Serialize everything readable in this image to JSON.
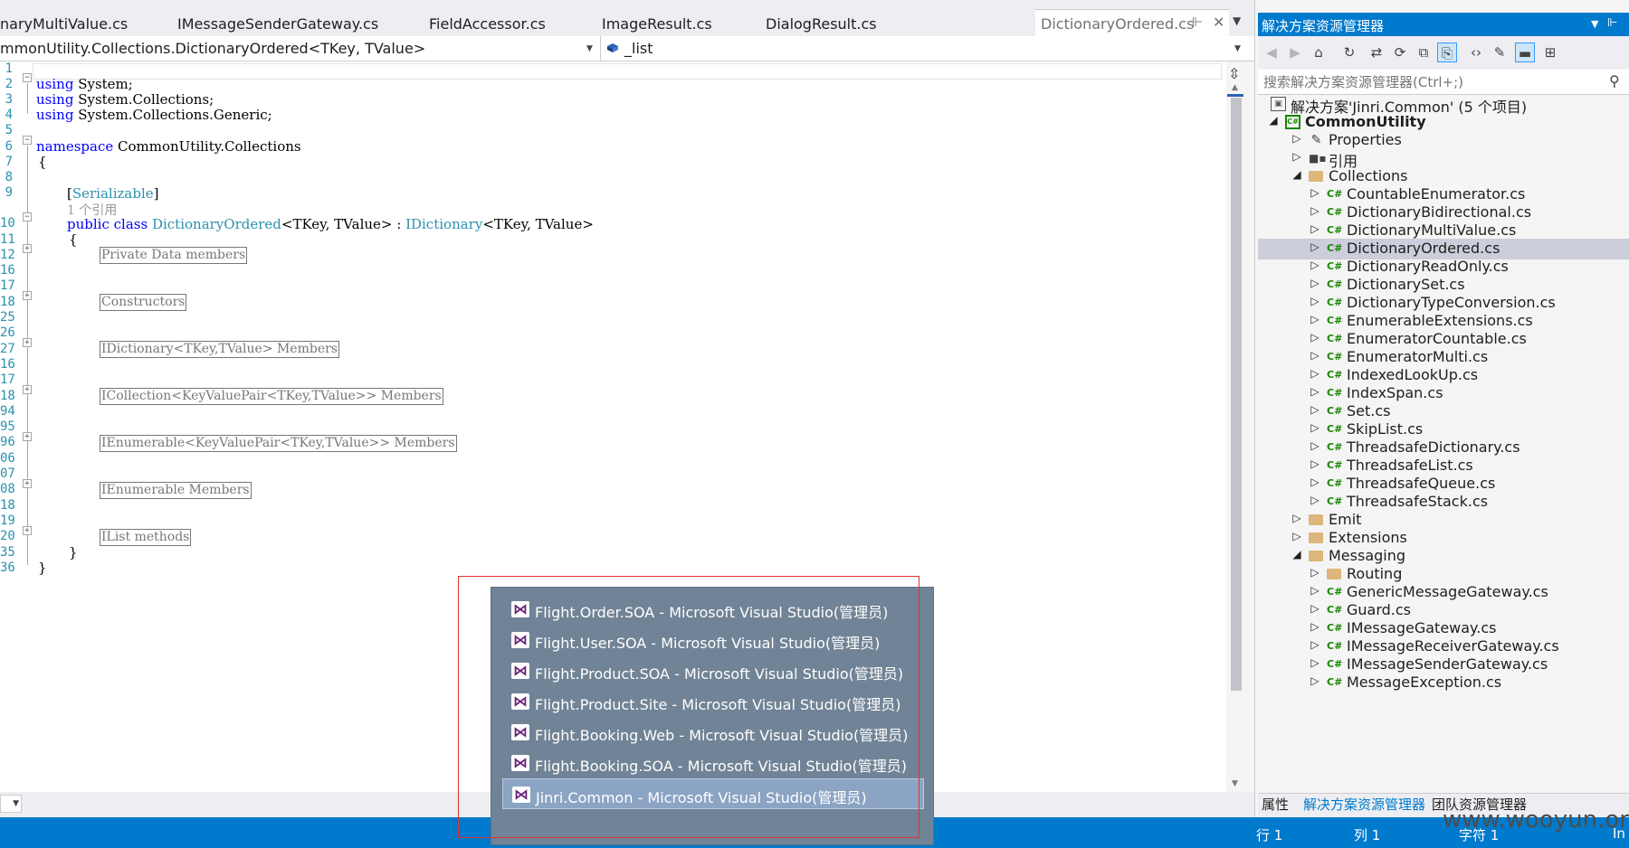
{
  "editor_tabs": [
    "naryMultiValue.cs",
    "IMessageSenderGateway.cs",
    "FieldAccessor.cs",
    "ImageResult.cs",
    "DialogResult.cs"
  ],
  "active_tab": {
    "label": "DictionaryOrdered.cs",
    "pin": "⊩",
    "close": "✕"
  },
  "tab_menu_icon": "chevron-down-icon",
  "nav": {
    "type_scope": "mmonUtility.Collections.DictionaryOrdered<TKey, TValue>",
    "member": "_list",
    "member_icon": "field-icon"
  },
  "line_numbers": [
    "1",
    "2",
    "3",
    "4",
    "5",
    "6",
    "7",
    "8",
    "9",
    "10",
    "11",
    "12",
    "16",
    "17",
    "18",
    "25",
    "26",
    "27",
    "16",
    "17",
    "18",
    "94",
    "95",
    "96",
    "06",
    "07",
    "08",
    "18",
    "19",
    "20",
    "35",
    "36"
  ],
  "code": {
    "using1_kw": "using",
    "using1": " System;",
    "using2_kw": "using",
    "using2": " System.Collections;",
    "using3_kw": "using",
    "using3": " System.Collections.Generic;",
    "ns_kw": "namespace",
    "ns": " CommonUtility.Collections",
    "brace_open": "{",
    "attr_open": "[",
    "attr": "Serializable",
    "attr_close": "]",
    "refs": "1 个引用",
    "class_kw": "public class",
    "class_name": "DictionaryOrdered",
    "class_generic": "<TKey, TValue> : ",
    "iface": "IDictionary",
    "iface_generic": "<TKey, TValue>",
    "class_brace_open": "{",
    "class_brace_close": "}",
    "ns_brace_close": "}",
    "regions": [
      "Private Data members",
      "Constructors",
      "IDictionary<TKey,TValue> Members",
      "ICollection<KeyValuePair<TKey,TValue>> Members",
      "IEnumerable<KeyValuePair<TKey,TValue>> Members",
      "IEnumerable Members",
      "IList methods"
    ]
  },
  "solution_explorer": {
    "title": "解决方案资源管理器",
    "search_placeholder": "搜索解决方案资源管理器(Ctrl+;)",
    "toolbar_icons": [
      "back-icon",
      "forward-icon",
      "home-icon",
      "sync-icon",
      "refresh-icon",
      "collapse-icon",
      "show-all-icon",
      "properties-icon",
      "code-icon",
      "wrench-icon",
      "pin-icon",
      "class-diagram-icon"
    ],
    "tree": [
      {
        "label": "解决方案'Jinri.Common' (5 个项目)",
        "kind": "solution",
        "level": 0,
        "exp": ""
      },
      {
        "label": "CommonUtility",
        "kind": "project",
        "level": 0,
        "exp": "open",
        "bold": true
      },
      {
        "label": "Properties",
        "kind": "wrench",
        "level": 1,
        "exp": "closed"
      },
      {
        "label": "引用",
        "kind": "refs",
        "level": 1,
        "exp": "closed"
      },
      {
        "label": "Collections",
        "kind": "folder",
        "level": 1,
        "exp": "open"
      },
      {
        "label": "CountableEnumerator.cs",
        "kind": "cs",
        "level": 2,
        "exp": "closed"
      },
      {
        "label": "DictionaryBidirectional.cs",
        "kind": "cs",
        "level": 2,
        "exp": "closed"
      },
      {
        "label": "DictionaryMultiValue.cs",
        "kind": "cs",
        "level": 2,
        "exp": "closed"
      },
      {
        "label": "DictionaryOrdered.cs",
        "kind": "cs",
        "level": 2,
        "exp": "closed",
        "selected": true
      },
      {
        "label": "DictionaryReadOnly.cs",
        "kind": "cs",
        "level": 2,
        "exp": "closed"
      },
      {
        "label": "DictionarySet.cs",
        "kind": "cs",
        "level": 2,
        "exp": "closed"
      },
      {
        "label": "DictionaryTypeConversion.cs",
        "kind": "cs",
        "level": 2,
        "exp": "closed"
      },
      {
        "label": "EnumerableExtensions.cs",
        "kind": "cs",
        "level": 2,
        "exp": "closed"
      },
      {
        "label": "EnumeratorCountable.cs",
        "kind": "cs",
        "level": 2,
        "exp": "closed"
      },
      {
        "label": "EnumeratorMulti.cs",
        "kind": "cs",
        "level": 2,
        "exp": "closed"
      },
      {
        "label": "IndexedLookUp.cs",
        "kind": "cs",
        "level": 2,
        "exp": "closed"
      },
      {
        "label": "IndexSpan.cs",
        "kind": "cs",
        "level": 2,
        "exp": "closed"
      },
      {
        "label": "Set.cs",
        "kind": "cs",
        "level": 2,
        "exp": "closed"
      },
      {
        "label": "SkipList.cs",
        "kind": "cs",
        "level": 2,
        "exp": "closed"
      },
      {
        "label": "ThreadsafeDictionary.cs",
        "kind": "cs",
        "level": 2,
        "exp": "closed"
      },
      {
        "label": "ThreadsafeList.cs",
        "kind": "cs",
        "level": 2,
        "exp": "closed"
      },
      {
        "label": "ThreadsafeQueue.cs",
        "kind": "cs",
        "level": 2,
        "exp": "closed"
      },
      {
        "label": "ThreadsafeStack.cs",
        "kind": "cs",
        "level": 2,
        "exp": "closed"
      },
      {
        "label": "Emit",
        "kind": "folder",
        "level": 1,
        "exp": "closed"
      },
      {
        "label": "Extensions",
        "kind": "folder",
        "level": 1,
        "exp": "closed"
      },
      {
        "label": "Messaging",
        "kind": "folder",
        "level": 1,
        "exp": "open"
      },
      {
        "label": "Routing",
        "kind": "folder",
        "level": 2,
        "exp": "closed"
      },
      {
        "label": "GenericMessageGateway.cs",
        "kind": "cs",
        "level": 2,
        "exp": "closed"
      },
      {
        "label": "Guard.cs",
        "kind": "cs",
        "level": 2,
        "exp": "closed"
      },
      {
        "label": "IMessageGateway.cs",
        "kind": "cs",
        "level": 2,
        "exp": "closed"
      },
      {
        "label": "IMessageReceiverGateway.cs",
        "kind": "cs",
        "level": 2,
        "exp": "closed"
      },
      {
        "label": "IMessageSenderGateway.cs",
        "kind": "cs",
        "level": 2,
        "exp": "closed"
      },
      {
        "label": "MessageException.cs",
        "kind": "cs",
        "level": 2,
        "exp": "closed"
      }
    ],
    "bottom_tabs": [
      "属性",
      "解决方案资源管理器",
      "团队资源管理器"
    ],
    "active_bottom_tab": 1
  },
  "status": {
    "line": "行 1",
    "col": "列 1",
    "char": "字符 1",
    "ins": "In"
  },
  "watermark": "www.wooyun.org",
  "switcher": {
    "items": [
      "Flight.Order.SOA - Microsoft Visual Studio(管理员)",
      "Flight.User.SOA - Microsoft Visual Studio(管理员)",
      "Flight.Product.SOA - Microsoft Visual Studio(管理员)",
      "Flight.Product.Site - Microsoft Visual Studio(管理员)",
      "Flight.Booking.Web - Microsoft Visual Studio(管理员)",
      "Flight.Booking.SOA - Microsoft Visual Studio(管理员)",
      "Jinri.Common - Microsoft Visual Studio(管理员)"
    ],
    "selected_index": 6,
    "item_icon": "visual-studio-icon"
  },
  "colors": {
    "accent": "#007acc",
    "keyword": "#0000ff",
    "type": "#2b91af",
    "switcher_bg": "#718396",
    "highlight_box": "#e03030"
  }
}
